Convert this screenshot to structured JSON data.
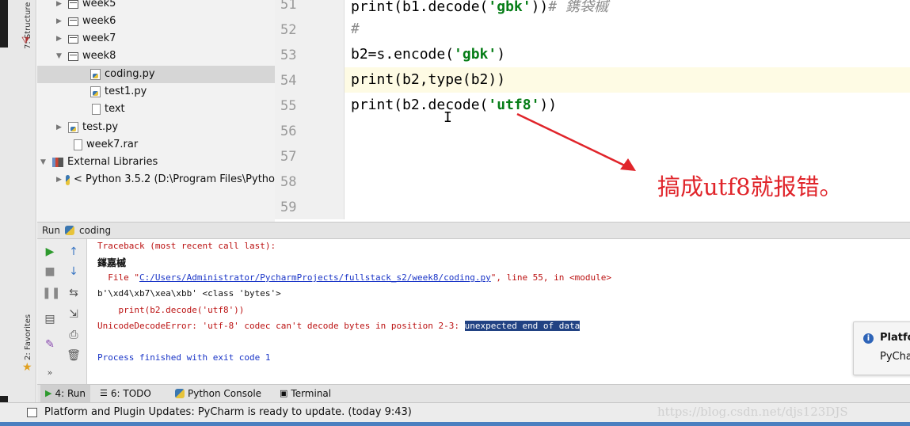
{
  "sidebar": {
    "structure_label": "7: Structure",
    "favorites_label": "2: Favorites"
  },
  "tree": {
    "items": [
      {
        "label": "week5",
        "type": "folder",
        "expanded": false
      },
      {
        "label": "week6",
        "type": "folder",
        "expanded": false
      },
      {
        "label": "week7",
        "type": "folder",
        "expanded": false
      },
      {
        "label": "week8",
        "type": "folder",
        "expanded": true
      },
      {
        "label": "coding.py",
        "type": "py",
        "selected": true
      },
      {
        "label": "test1.py",
        "type": "py"
      },
      {
        "label": "text",
        "type": "txt"
      },
      {
        "label": "test.py",
        "type": "py"
      },
      {
        "label": "week7.rar",
        "type": "file"
      },
      {
        "label": "External Libraries",
        "type": "lib"
      },
      {
        "label": "< Python 3.5.2 (D:\\Program Files\\Pytho",
        "type": "pyenv"
      }
    ]
  },
  "editor": {
    "line_numbers": [
      "51",
      "52",
      "53",
      "54",
      "55",
      "56",
      "57",
      "58",
      "59"
    ],
    "lines": {
      "l51_a": "print(b1.decode(",
      "l51_str": "'gbk'",
      "l51_b": "))",
      "l51_comment": "# 鎸袋槭",
      "l52": "#",
      "l53_a": "b2=s.encode(",
      "l53_str": "'gbk'",
      "l53_b": ")",
      "l54": "print(b2,type(b2))",
      "l55_a": "print(b2.decode(",
      "l55_str": "'utf8'",
      "l55_b": "))"
    },
    "annotation": "搞成utf8就报错。",
    "annotation_color": "#e0242a"
  },
  "run": {
    "header_label": "Run",
    "config_name": "coding",
    "console": {
      "l1": "Traceback (most recent call last):",
      "l2": "鎽嘉槭",
      "l3_a": "  File \"",
      "l3_link": "C:/Users/Administrator/PycharmProjects/fullstack_s2/week8/coding.py",
      "l3_b": "\", line 55, in <module>",
      "l4": "b'\\xd4\\xb7\\xea\\xbb' <class 'bytes'>",
      "l5": "    print(b2.decode('utf8'))",
      "l6_a": "UnicodeDecodeError: 'utf-8' codec can't decode bytes in position 2-3: ",
      "l6_sel": "unexpected end of data",
      "l7": "Process finished with exit code 1"
    }
  },
  "notification": {
    "title": "Platfo",
    "body": "PyCha"
  },
  "tabs": [
    {
      "label": "4: Run",
      "icon": "run-icon"
    },
    {
      "label": "6: TODO",
      "icon": "todo-icon"
    },
    {
      "label": "Python Console",
      "icon": "python-console-icon"
    },
    {
      "label": "Terminal",
      "icon": "terminal-icon"
    }
  ],
  "status": {
    "message": "Platform and Plugin Updates: PyCharm is ready to update. (today 9:43)"
  },
  "watermark": "https://blog.csdn.net/djs123DJS"
}
